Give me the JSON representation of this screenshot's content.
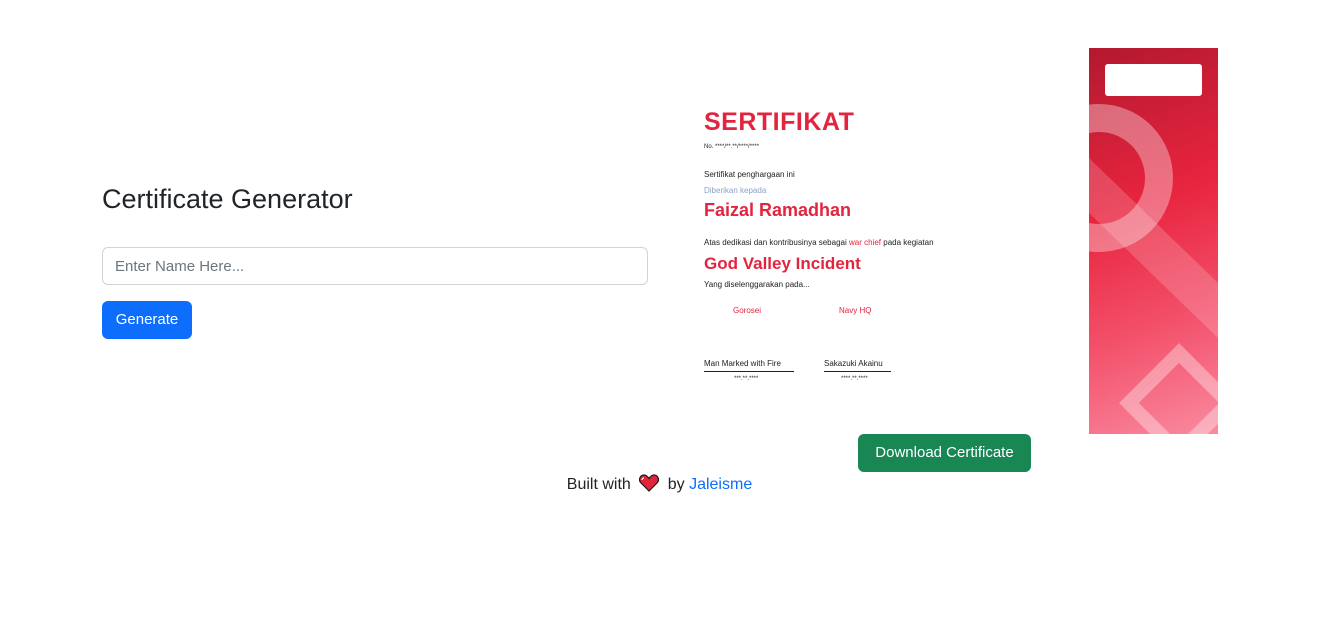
{
  "form": {
    "title": "Certificate Generator",
    "name_placeholder": "Enter Name Here...",
    "generate_label": "Generate",
    "download_label": "Download Certificate"
  },
  "certificate": {
    "heading": "SERTIFIKAT",
    "number": "No. ****/**.**/****/****",
    "intro": "Sertifikat penghargaan ini",
    "given_to": "Diberikan kepada",
    "recipient": "Faizal Ramadhan",
    "dedication_pre": "Atas dedikasi dan kontribusinya sebagai",
    "role": "war chief",
    "dedication_post": "pada kegiatan",
    "event": "God Valley Incident",
    "organized_by": "Yang diselenggarakan pada...",
    "org_left": "Gorosei",
    "org_right": "Navy HQ",
    "signer_left": "Man Marked with Fire",
    "signer_left_id": "***.**.****",
    "signer_right": "Sakazuki Akainu",
    "signer_right_id": "****.**.****"
  },
  "footer": {
    "built_with": "Built with",
    "by": "by",
    "author": "Jaleisme"
  },
  "colors": {
    "accent_red": "#e3243f",
    "primary_blue": "#0d6efd",
    "success_green": "#198754"
  }
}
